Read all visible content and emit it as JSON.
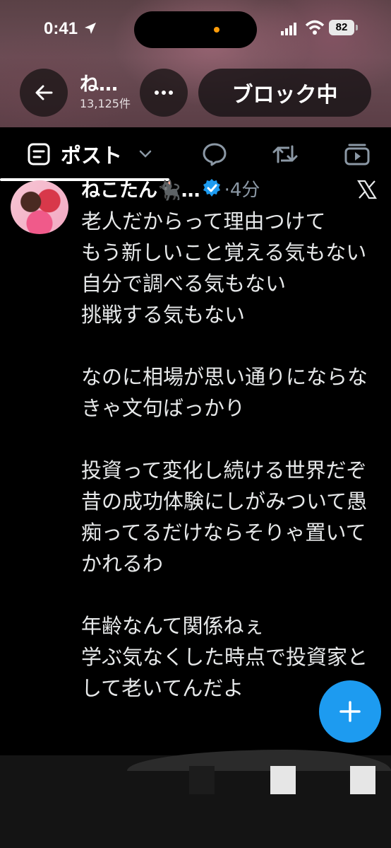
{
  "status_bar": {
    "time": "0:41",
    "battery": "82"
  },
  "header": {
    "profile_name": "ね…",
    "post_count": "13,125件",
    "block_label": "ブロック中",
    "back_icon": "back-arrow-icon",
    "more_icon": "more-dots-icon"
  },
  "tabs": [
    {
      "label": "ポスト",
      "icon": "posts-icon",
      "selected": true
    },
    {
      "icon": "replies-icon"
    },
    {
      "icon": "repost-icon"
    },
    {
      "icon": "media-icon"
    }
  ],
  "tweet": {
    "author": "ねこたん🐈‍⬛…",
    "time": "·4分",
    "text": "老人だからって理由つけて\nもう新しいこと覚える気もない\n自分で調べる気もない\n挑戦する気もない\n\nなのに相場が思い通りにならなきゃ文句ばっかり\n\n投資って変化し続ける世界だぞ\n昔の成功体験にしがみついて愚痴ってるだけならそりゃ置いてかれるわ\n\n年齢なんて関係ねぇ\n学ぶ気なくした時点で投資家として老いてんだよ"
  },
  "fab": {
    "icon": "plus-icon"
  },
  "colors": {
    "accent": "#1d9bf0",
    "verified": "#1d9bf0"
  }
}
